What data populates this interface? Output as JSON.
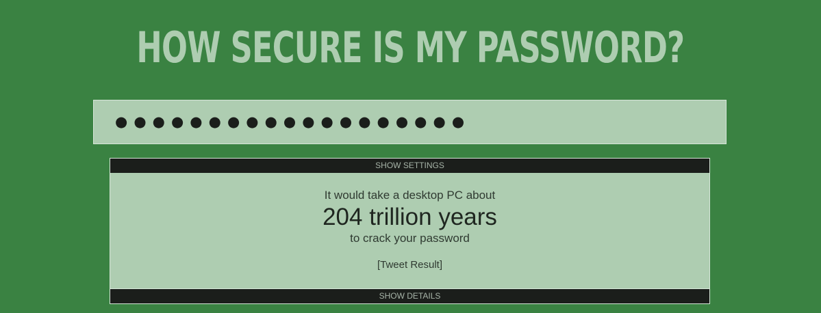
{
  "header": {
    "title": "HOW SECURE IS MY PASSWORD?"
  },
  "password_input": {
    "masked_value": "●●●●●●●●●●●●●●●●●●●"
  },
  "settings_toggle": {
    "label": "SHOW SETTINGS"
  },
  "result": {
    "prefix": "It would take a desktop PC about",
    "time": "204 trillion years",
    "suffix": "to crack your password",
    "tweet_link": "[Tweet Result]"
  },
  "details_toggle": {
    "label": "SHOW DETAILS"
  },
  "colors": {
    "background": "#3a8242",
    "panel": "#aecdb1",
    "bar": "#1b1e1b",
    "title": "#aecdb1"
  }
}
